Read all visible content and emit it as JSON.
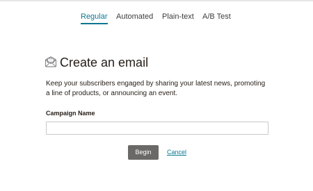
{
  "tabs": [
    {
      "label": "Regular",
      "active": true
    },
    {
      "label": "Automated",
      "active": false
    },
    {
      "label": "Plain-text",
      "active": false
    },
    {
      "label": "A/B Test",
      "active": false
    }
  ],
  "header": {
    "title": "Create an email",
    "icon": "email-envelope-icon"
  },
  "description": "Keep your subscribers engaged by sharing your latest news, promoting a line of products, or announcing an event.",
  "form": {
    "campaign_name_label": "Campaign Name",
    "campaign_name_value": "",
    "campaign_name_placeholder": ""
  },
  "actions": {
    "begin_label": "Begin",
    "cancel_label": "Cancel"
  },
  "colors": {
    "accent": "#0b7792",
    "button_bg": "#6b6868",
    "text": "#241c15"
  }
}
